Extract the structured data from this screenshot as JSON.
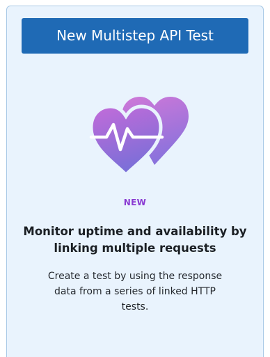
{
  "card": {
    "button_label": "New Multistep API Test",
    "badge": "NEW",
    "headline": "Monitor uptime and availability by linking multiple requests",
    "description": "Create a test by using the response data from a series of linked HTTP tests.",
    "illustration_icon": "heartbeat-hearts-icon"
  },
  "colors": {
    "button_bg": "#1f6ab5",
    "card_bg": "#e9f3fd",
    "badge_text": "#8a3ad2",
    "heart_gradient_start": "#c36bd9",
    "heart_gradient_end": "#7b6fd8"
  }
}
